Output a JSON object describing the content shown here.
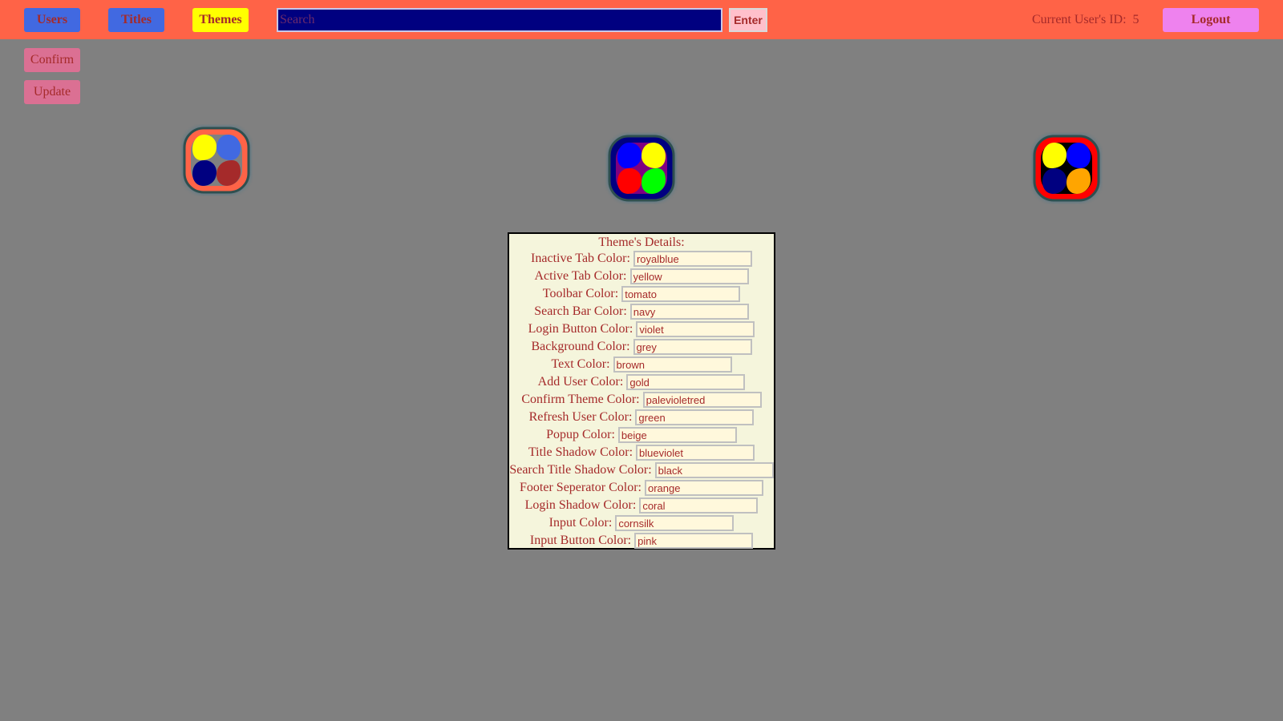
{
  "toolbar": {
    "tabs": [
      {
        "label": "Users"
      },
      {
        "label": "Titles"
      },
      {
        "label": "Themes"
      }
    ],
    "search": {
      "placeholder": "Search",
      "value": ""
    },
    "enter_label": "Enter",
    "user_id_label": "Current User's ID:",
    "user_id_value": "5",
    "logout_label": "Logout"
  },
  "side_buttons": {
    "confirm": "Confirm",
    "update": "Update"
  },
  "themes": [
    {
      "frame": "#ff6347",
      "fill": "#808080",
      "dots": [
        "#ffff00",
        "#4169e1",
        "#000080",
        "#a52a2a"
      ]
    },
    {
      "frame": "#000080",
      "fill": "#800080",
      "dots": [
        "#0000ff",
        "#ffff00",
        "#ff0000",
        "#00ff00"
      ]
    },
    {
      "frame": "#ff0000",
      "fill": "#000000",
      "dots": [
        "#ffff00",
        "#0000ff",
        "#000080",
        "#ffa500"
      ]
    }
  ],
  "details": {
    "title": "Theme's Details:",
    "fields": [
      {
        "label": "Inactive Tab Color:",
        "value": "royalblue"
      },
      {
        "label": "Active Tab Color:",
        "value": "yellow"
      },
      {
        "label": "Toolbar Color:",
        "value": "tomato"
      },
      {
        "label": "Search Bar Color:",
        "value": "navy"
      },
      {
        "label": "Login Button Color:",
        "value": "violet"
      },
      {
        "label": "Background Color:",
        "value": "grey"
      },
      {
        "label": "Text Color:",
        "value": "brown"
      },
      {
        "label": "Add User Color:",
        "value": "gold"
      },
      {
        "label": "Confirm Theme Color:",
        "value": "palevioletred"
      },
      {
        "label": "Refresh User Color:",
        "value": "green"
      },
      {
        "label": "Popup Color:",
        "value": "beige"
      },
      {
        "label": "Title Shadow Color:",
        "value": "blueviolet"
      },
      {
        "label": "Search Title Shadow Color:",
        "value": "black"
      },
      {
        "label": "Footer Seperator Color:",
        "value": "orange"
      },
      {
        "label": "Login Shadow Color:",
        "value": "coral"
      },
      {
        "label": "Input Color:",
        "value": "cornsilk"
      },
      {
        "label": "Input Button Color:",
        "value": "pink"
      }
    ]
  },
  "colors": {
    "toolbar": "#ff6347",
    "background": "#808080",
    "text": "#a52a2a",
    "inactive_tab": "#4169e1",
    "active_tab": "#ffff00",
    "search_bar": "#000080",
    "logout": "#ee82ee",
    "side_buttons": "#db7093",
    "popup": "#f5f5dc",
    "input": "#fff8dc",
    "input_button": "#ffc0cb"
  }
}
